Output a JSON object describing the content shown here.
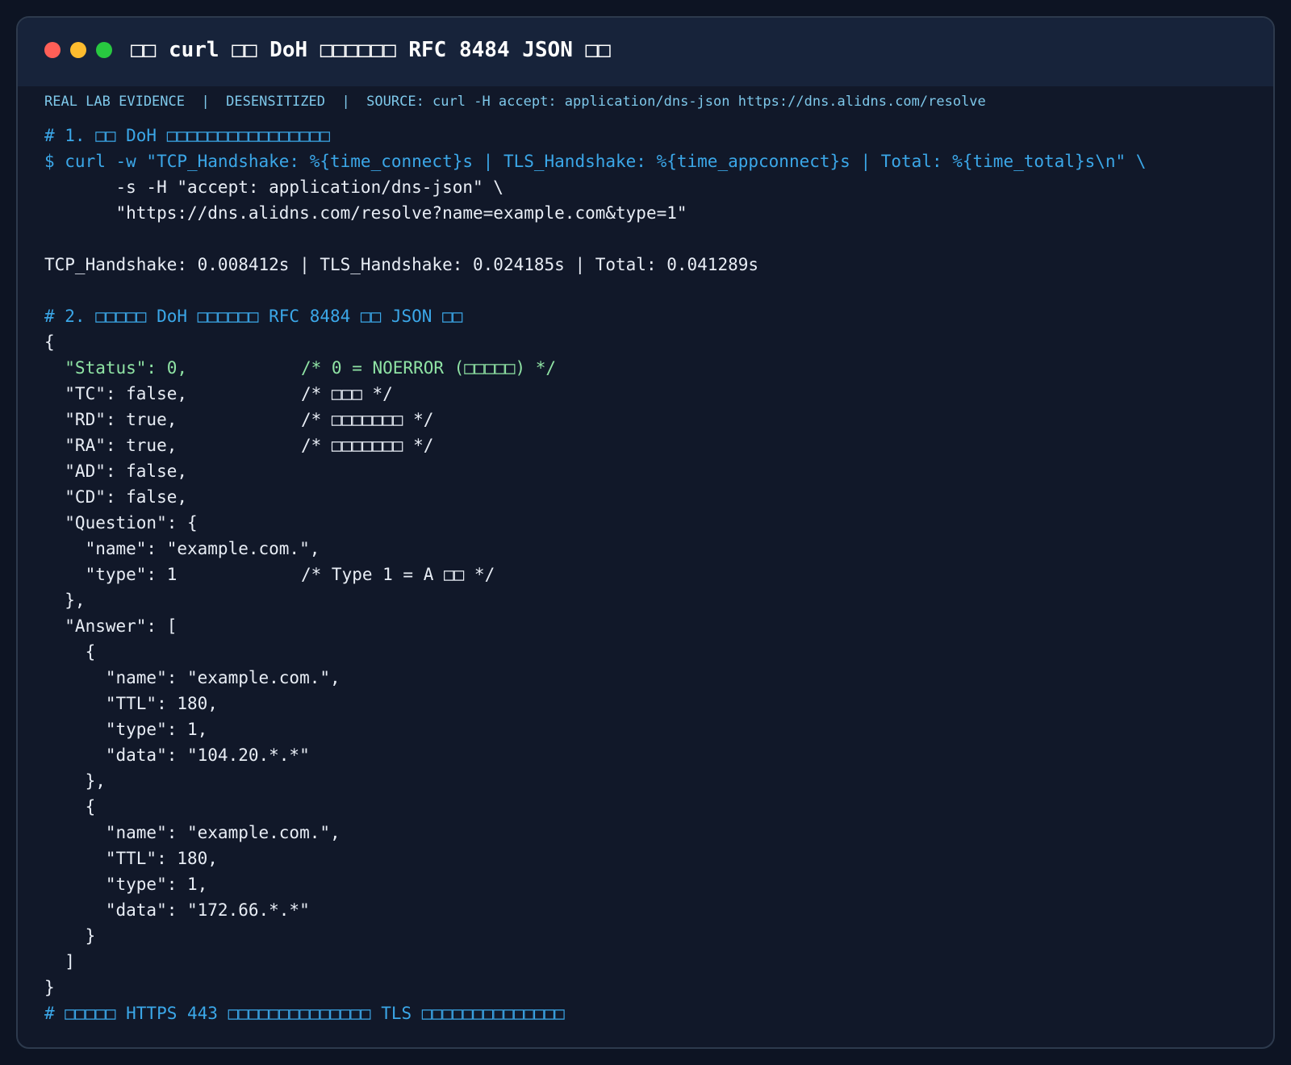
{
  "window": {
    "title": "□□ curl □□ DoH □□□□□□ RFC 8484 JSON □□",
    "meta": "REAL LAB EVIDENCE  |  DESENSITIZED  |  SOURCE: curl -H accept: application/dns-json https://dns.alidns.com/resolve"
  },
  "colors": {
    "background": "#0d1423",
    "window": "#111829",
    "titlebar": "#17233a",
    "accent": "#3ba7e8",
    "green": "#8fe3a4",
    "text": "#e8edf5"
  },
  "icons": [
    "close-dot-icon",
    "minimize-dot-icon",
    "maximize-dot-icon"
  ],
  "code_lines": [
    {
      "text": "# 1. □□ DoH □□□□□□□□□□□□□□□□",
      "style": "comment",
      "comment": ""
    },
    {
      "text": "$ curl -w \"TCP_Handshake: %{time_connect}s | TLS_Handshake: %{time_appconnect}s | Total: %{time_total}s\\n\" \\",
      "style": "cmd",
      "comment": ""
    },
    {
      "text": "       -s -H \"accept: application/dns-json\" \\",
      "style": "text",
      "comment": ""
    },
    {
      "text": "       \"https://dns.alidns.com/resolve?name=example.com&type=1\"",
      "style": "text",
      "comment": ""
    },
    {
      "text": "",
      "style": "text",
      "comment": ""
    },
    {
      "text": "TCP_Handshake: 0.008412s | TLS_Handshake: 0.024185s | Total: 0.041289s",
      "style": "text",
      "comment": ""
    },
    {
      "text": "",
      "style": "text",
      "comment": ""
    },
    {
      "text": "# 2. □□□□□ DoH □□□□□□ RFC 8484 □□ JSON □□",
      "style": "comment",
      "comment": ""
    },
    {
      "text": "{",
      "style": "text",
      "comment": ""
    },
    {
      "text": "  \"Status\": 0,",
      "style": "green",
      "comment": "/* 0 = NOERROR (□□□□□) */"
    },
    {
      "text": "  \"TC\": false,",
      "style": "text",
      "comment": "/* □□□ */"
    },
    {
      "text": "  \"RD\": true,",
      "style": "text",
      "comment": "/* □□□□□□□ */"
    },
    {
      "text": "  \"RA\": true,",
      "style": "text",
      "comment": "/* □□□□□□□ */"
    },
    {
      "text": "  \"AD\": false,",
      "style": "text",
      "comment": ""
    },
    {
      "text": "  \"CD\": false,",
      "style": "text",
      "comment": ""
    },
    {
      "text": "  \"Question\": {",
      "style": "text",
      "comment": ""
    },
    {
      "text": "    \"name\": \"example.com.\",",
      "style": "text",
      "comment": ""
    },
    {
      "text": "    \"type\": 1",
      "style": "text",
      "comment": "/* Type 1 = A □□ */"
    },
    {
      "text": "  },",
      "style": "text",
      "comment": ""
    },
    {
      "text": "  \"Answer\": [",
      "style": "text",
      "comment": ""
    },
    {
      "text": "    {",
      "style": "text",
      "comment": ""
    },
    {
      "text": "      \"name\": \"example.com.\",",
      "style": "text",
      "comment": ""
    },
    {
      "text": "      \"TTL\": 180,",
      "style": "text",
      "comment": ""
    },
    {
      "text": "      \"type\": 1,",
      "style": "text",
      "comment": ""
    },
    {
      "text": "      \"data\": \"104.20.*.*\"",
      "style": "text",
      "comment": ""
    },
    {
      "text": "    },",
      "style": "text",
      "comment": ""
    },
    {
      "text": "    {",
      "style": "text",
      "comment": ""
    },
    {
      "text": "      \"name\": \"example.com.\",",
      "style": "text",
      "comment": ""
    },
    {
      "text": "      \"TTL\": 180,",
      "style": "text",
      "comment": ""
    },
    {
      "text": "      \"type\": 1,",
      "style": "text",
      "comment": ""
    },
    {
      "text": "      \"data\": \"172.66.*.*\"",
      "style": "text",
      "comment": ""
    },
    {
      "text": "    }",
      "style": "text",
      "comment": ""
    },
    {
      "text": "  ]",
      "style": "text",
      "comment": ""
    },
    {
      "text": "}",
      "style": "text",
      "comment": ""
    },
    {
      "text": "# □□□□□ HTTPS 443 □□□□□□□□□□□□□□ TLS □□□□□□□□□□□□□□",
      "style": "comment",
      "comment": ""
    }
  ]
}
